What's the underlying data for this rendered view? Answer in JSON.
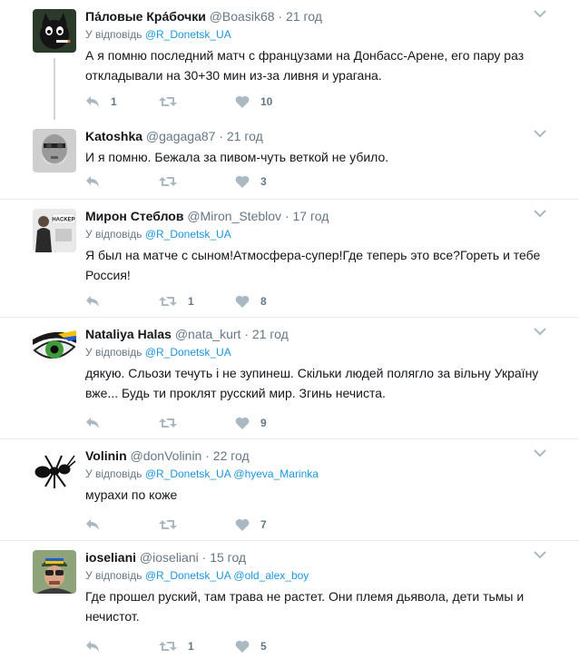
{
  "colors": {
    "link": "#1b95e0",
    "muted": "#657786",
    "icon": "#aab8c2",
    "divider": "#e6ecf0"
  },
  "tweets": [
    {
      "fullname": "Па́ловые Кра́бочки",
      "username": "@Boasik68",
      "sep": "·",
      "time": "21 год",
      "reply_prefix": "У відповідь",
      "mentions": [
        "@R_Donetsk_UA"
      ],
      "text": "А я помню последний матч с французами на Донбасс-Арене, его пару раз откладывали на 30+30 мин из-за ливня и урагана.",
      "replies": "1",
      "retweets": "",
      "likes": "10",
      "avatar_icon": "cat-with-cigarette-avatar"
    },
    {
      "fullname": "Katoshka",
      "username": "@gagaga87",
      "sep": "·",
      "time": "21 год",
      "text": "И я помню. Бежала за пивом-чуть веткой не убило.",
      "replies": "",
      "retweets": "",
      "likes": "3",
      "avatar_icon": "bearded-man-avatar"
    },
    {
      "fullname": "Мирон Стеблов",
      "username": "@Miron_Steblov",
      "sep": "·",
      "time": "17 год",
      "reply_prefix": "У відповідь",
      "mentions": [
        "@R_Donetsk_UA"
      ],
      "text": "Я был на матче с сыном!Атмосфера-супер!Где теперь это все?Гореть и тебе Россия!",
      "replies": "",
      "retweets": "1",
      "likes": "8",
      "avatar_icon": "man-in-suit-avatar",
      "avatar_text": "HACKEP"
    },
    {
      "fullname": "Nataliya Halas",
      "username": "@nata_kurt",
      "sep": "·",
      "time": "21 год",
      "reply_prefix": "У відповідь",
      "mentions": [
        "@R_Donetsk_UA"
      ],
      "text": "дякую. Сльози течуть і не зупинеш. Скільки людей полягло за вільну Україну вже... Будь ти проклят русский мир. Згинь нечиста.",
      "replies": "",
      "retweets": "",
      "likes": "9",
      "avatar_icon": "green-eye-avatar"
    },
    {
      "fullname": "Volinin",
      "username": "@donVolinin",
      "sep": "·",
      "time": "22 год",
      "reply_prefix": "У відповідь",
      "mentions": [
        "@R_Donetsk_UA",
        "@hyeva_Marinka"
      ],
      "text": "мурахи по коже",
      "replies": "",
      "retweets": "",
      "likes": "7",
      "avatar_icon": "ant-avatar"
    },
    {
      "fullname": "ioseliani",
      "username": "@ioseliani",
      "sep": "·",
      "time": "15 год",
      "reply_prefix": "У відповідь",
      "mentions": [
        "@R_Donetsk_UA",
        "@old_alex_boy"
      ],
      "text": "Где прошел руский, там трава не растет. Они племя дьявола, дети тьмы и нечистот.",
      "replies": "",
      "retweets": "1",
      "likes": "5",
      "avatar_icon": "man-with-helmet-avatar"
    }
  ]
}
